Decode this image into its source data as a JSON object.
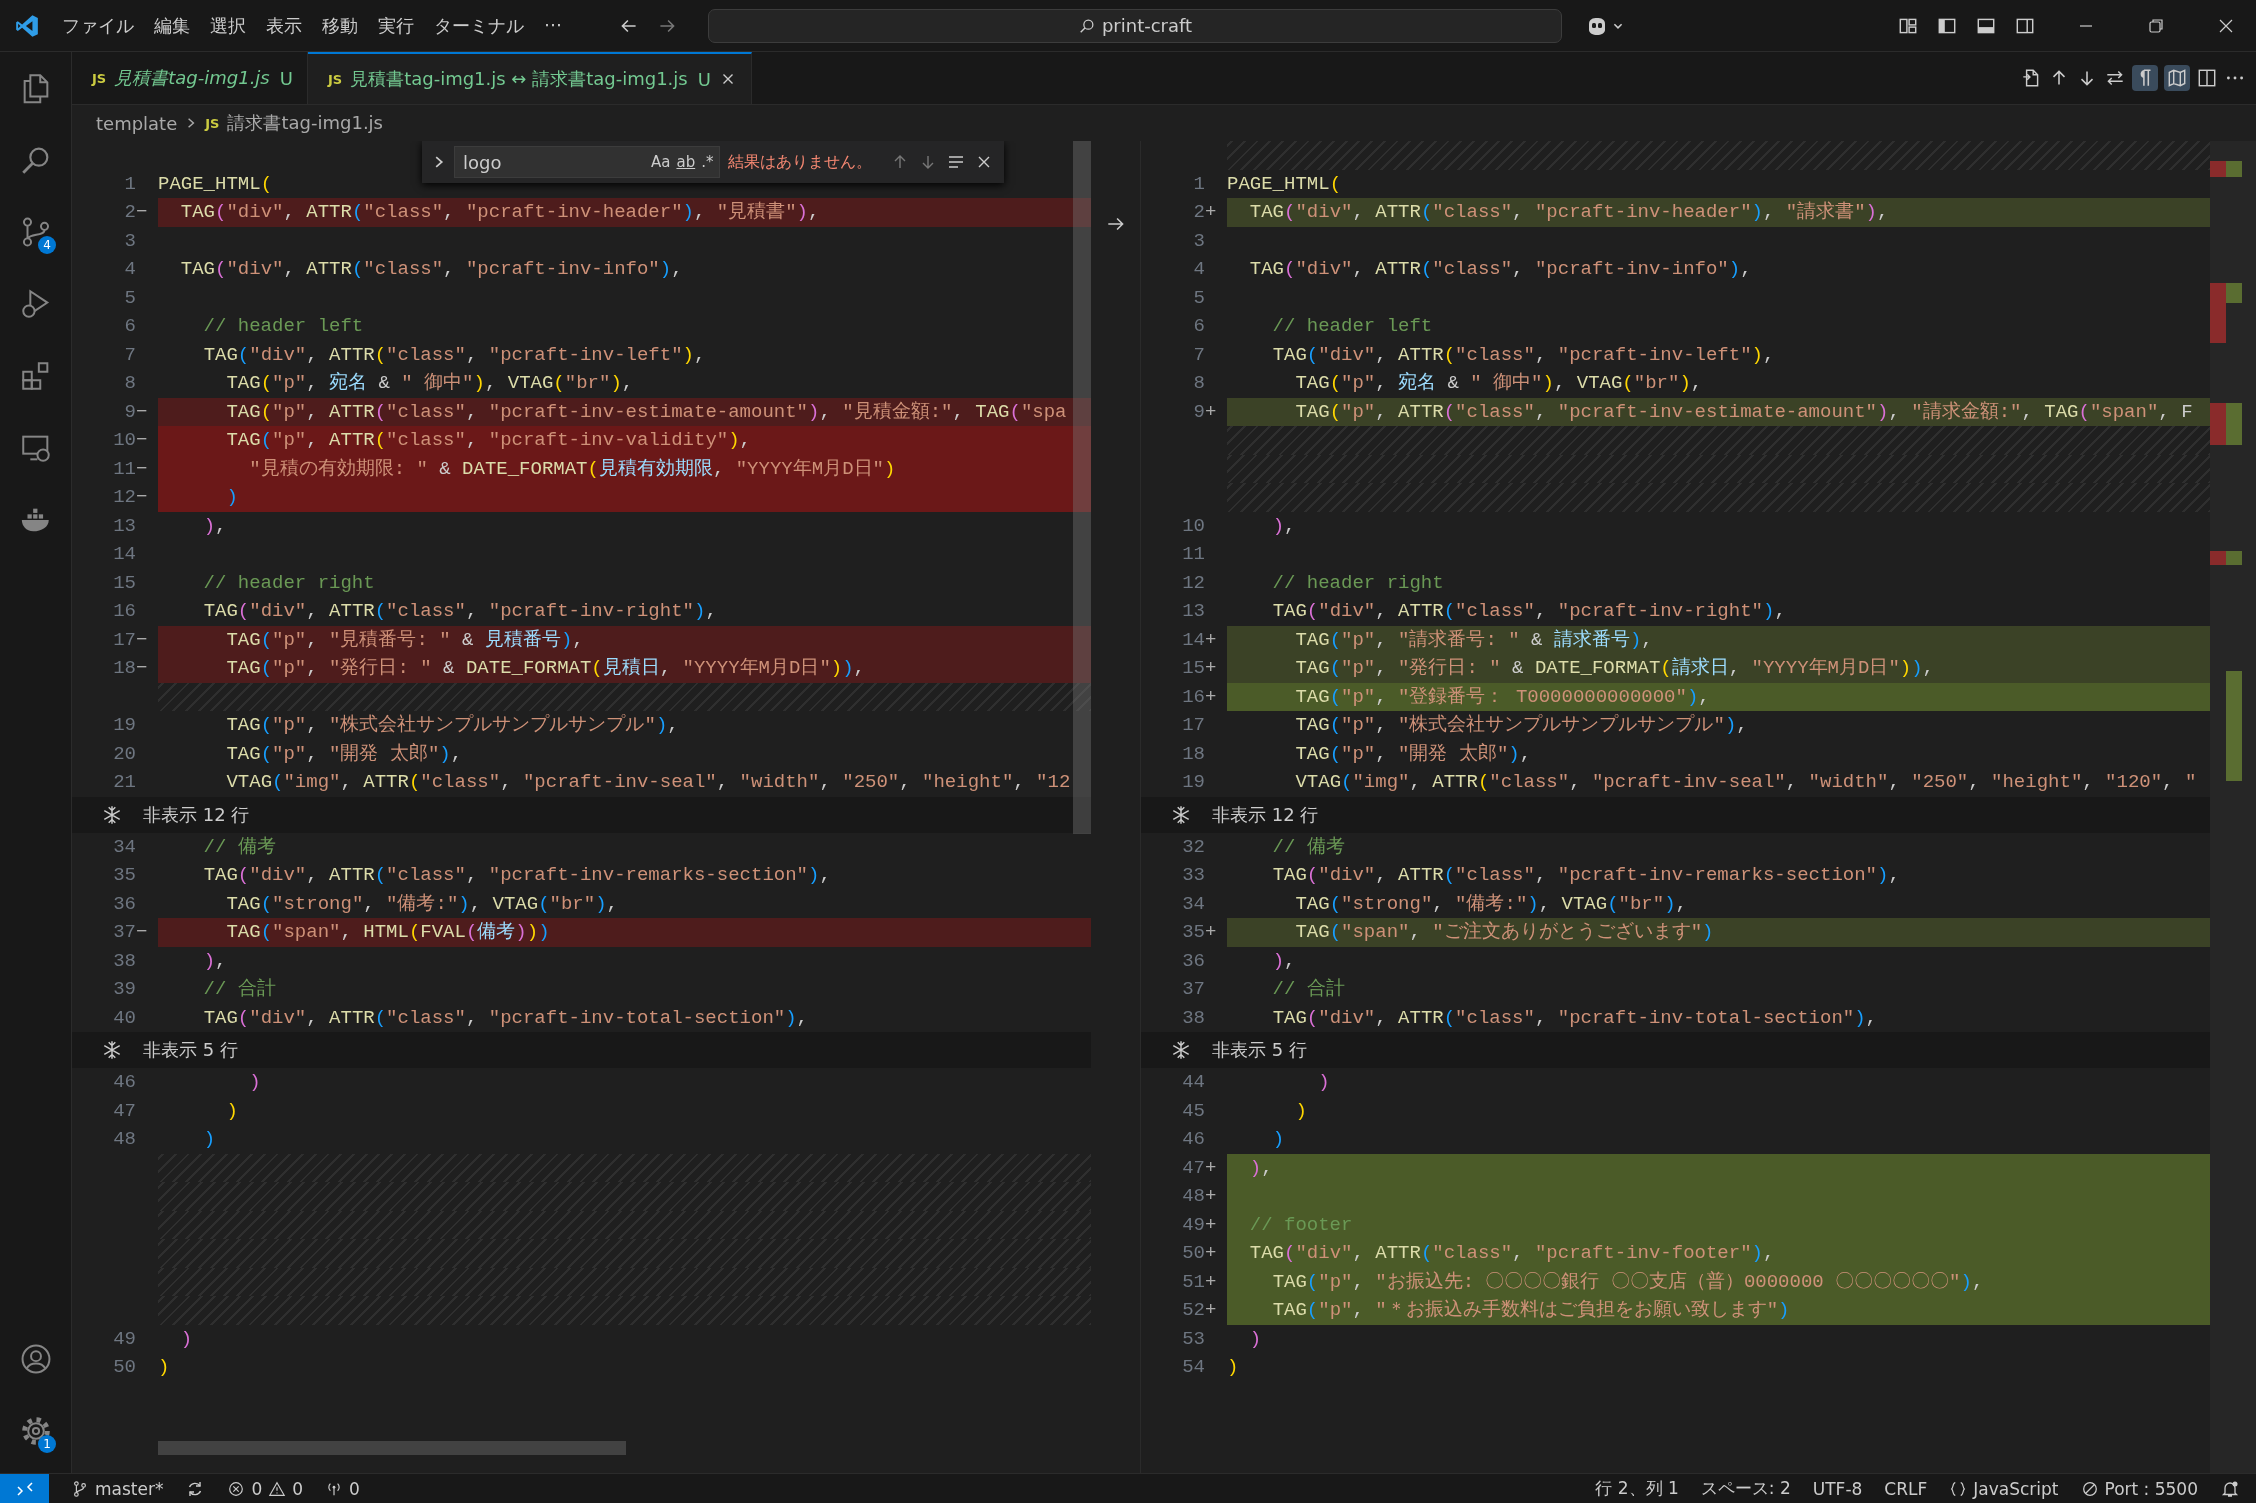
{
  "title_bar": {
    "menu": [
      "ファイル",
      "編集",
      "選択",
      "表示",
      "移動",
      "実行",
      "ターミナル",
      "⋯"
    ],
    "command_center": "print-craft"
  },
  "activity_bar": {
    "source_control_badge": "4",
    "manage_badge": "1"
  },
  "tabs": [
    {
      "file_type": "JS",
      "label": "見積書tag-img1.js",
      "status": "U",
      "selected": false,
      "preview": true
    },
    {
      "file_type": "JS",
      "label": "見積書tag-img1.js ↔ 請求書tag-img1.js",
      "status": "U",
      "selected": true,
      "preview": false
    }
  ],
  "editor_toolbar": {
    "whitespace_toggle_on": true,
    "collapse_unchanged_on": true
  },
  "breadcrumb": {
    "folder": "template",
    "file_type": "JS",
    "file": "請求書tag-img1.js"
  },
  "find_widget": {
    "query": "logo",
    "options": [
      "Aa",
      "ab",
      ".*"
    ],
    "message": "結果はありません。"
  },
  "diff": {
    "left": {
      "rows": [
        {
          "kind": "blank"
        },
        {
          "kind": "line",
          "number": "1",
          "changed": false,
          "whole": false,
          "code": "PAGE_HTML("
        },
        {
          "kind": "line",
          "number": "2",
          "marker": "−",
          "changed": true,
          "whole": false,
          "code": "  TAG(\"div\", ATTR(\"class\", \"pcraft-inv-header\"), \"見積書\"),"
        },
        {
          "kind": "line",
          "number": "3",
          "changed": false,
          "whole": false
        },
        {
          "kind": "line",
          "number": "4",
          "changed": false,
          "whole": false,
          "code": "  TAG(\"div\", ATTR(\"class\", \"pcraft-inv-info\"),"
        },
        {
          "kind": "line",
          "number": "5",
          "changed": false,
          "whole": false
        },
        {
          "kind": "line",
          "number": "6",
          "changed": false,
          "whole": false,
          "code": "    // header left"
        },
        {
          "kind": "line",
          "number": "7",
          "changed": false,
          "whole": false,
          "code": "    TAG(\"div\", ATTR(\"class\", \"pcraft-inv-left\"),"
        },
        {
          "kind": "line",
          "number": "8",
          "changed": false,
          "whole": false,
          "code": "      TAG(\"p\", 宛名 & \" 御中\"), VTAG(\"br\"),"
        },
        {
          "kind": "line",
          "number": "9",
          "marker": "−",
          "changed": true,
          "whole": false,
          "code": "      TAG(\"p\", ATTR(\"class\", \"pcraft-inv-estimate-amount\"), \"見積金額:\", TAG(\"spa"
        },
        {
          "kind": "line",
          "number": "10",
          "marker": "−",
          "changed": true,
          "whole": true,
          "code": "      TAG(\"p\", ATTR(\"class\", \"pcraft-inv-validity\"),"
        },
        {
          "kind": "line",
          "number": "11",
          "marker": "−",
          "changed": true,
          "whole": true,
          "code": "        \"見積の有効期限: \" & DATE_FORMAT(見積有効期限, \"YYYY年M月D日\")"
        },
        {
          "kind": "line",
          "number": "12",
          "marker": "−",
          "changed": true,
          "whole": true,
          "code": "      )"
        },
        {
          "kind": "line",
          "number": "13",
          "changed": false,
          "whole": false,
          "code": "    ),"
        },
        {
          "kind": "line",
          "number": "14",
          "changed": false,
          "whole": false
        },
        {
          "kind": "line",
          "number": "15",
          "changed": false,
          "whole": false,
          "code": "    // header right"
        },
        {
          "kind": "line",
          "number": "16",
          "changed": false,
          "whole": false,
          "code": "    TAG(\"div\", ATTR(\"class\", \"pcraft-inv-right\"),"
        },
        {
          "kind": "line",
          "number": "17",
          "marker": "−",
          "changed": true,
          "whole": false,
          "code": "      TAG(\"p\", \"見積番号: \" & 見積番号),"
        },
        {
          "kind": "line",
          "number": "18",
          "marker": "−",
          "changed": true,
          "whole": false,
          "code": "      TAG(\"p\", \"発行日: \" & DATE_FORMAT(見積日, \"YYYY年M月D日\")),"
        },
        {
          "kind": "filler"
        },
        {
          "kind": "line",
          "number": "19",
          "changed": false,
          "whole": false,
          "code": "      TAG(\"p\", \"株式会社サンプルサンプルサンプル\"),"
        },
        {
          "kind": "line",
          "number": "20",
          "changed": false,
          "whole": false,
          "code": "      TAG(\"p\", \"開発 太郎\"),"
        },
        {
          "kind": "line",
          "number": "21",
          "changed": false,
          "whole": false,
          "code": "      VTAG(\"img\", ATTR(\"class\", \"pcraft-inv-seal\", \"width\", \"250\", \"height\", \"12"
        },
        {
          "kind": "fold",
          "label": "非表示 12 行"
        },
        {
          "kind": "line",
          "number": "34",
          "changed": false,
          "whole": false,
          "code": "    // 備考"
        },
        {
          "kind": "line",
          "number": "35",
          "changed": false,
          "whole": false,
          "code": "    TAG(\"div\", ATTR(\"class\", \"pcraft-inv-remarks-section\"),"
        },
        {
          "kind": "line",
          "number": "36",
          "changed": false,
          "whole": false,
          "code": "      TAG(\"strong\", \"備考:\"), VTAG(\"br\"),"
        },
        {
          "kind": "line",
          "number": "37",
          "marker": "−",
          "changed": true,
          "whole": false,
          "code": "      TAG(\"span\", HTML(FVAL(備考)))"
        },
        {
          "kind": "line",
          "number": "38",
          "changed": false,
          "whole": false,
          "code": "    ),"
        },
        {
          "kind": "line",
          "number": "39",
          "changed": false,
          "whole": false,
          "code": "    // 合計"
        },
        {
          "kind": "line",
          "number": "40",
          "changed": false,
          "whole": false,
          "code": "    TAG(\"div\", ATTR(\"class\", \"pcraft-inv-total-section\"),"
        },
        {
          "kind": "fold",
          "label": "非表示 5 行"
        },
        {
          "kind": "line",
          "number": "46",
          "changed": false,
          "whole": false,
          "code": "        )"
        },
        {
          "kind": "line",
          "number": "47",
          "changed": false,
          "whole": false,
          "code": "      )"
        },
        {
          "kind": "line",
          "number": "48",
          "changed": false,
          "whole": false,
          "code": "    )"
        },
        {
          "kind": "filler"
        },
        {
          "kind": "filler"
        },
        {
          "kind": "filler"
        },
        {
          "kind": "filler"
        },
        {
          "kind": "filler"
        },
        {
          "kind": "filler"
        },
        {
          "kind": "line",
          "number": "49",
          "changed": false,
          "whole": false,
          "code": "  )"
        },
        {
          "kind": "line",
          "number": "50",
          "changed": false,
          "whole": false,
          "code": ")"
        }
      ]
    },
    "right": {
      "rows": [
        {
          "kind": "filler"
        },
        {
          "kind": "line",
          "number": "1",
          "changed": false,
          "whole": false,
          "code": "PAGE_HTML("
        },
        {
          "kind": "line",
          "number": "2",
          "marker": "+",
          "changed": true,
          "whole": false,
          "code": "  TAG(\"div\", ATTR(\"class\", \"pcraft-inv-header\"), \"請求書\"),"
        },
        {
          "kind": "line",
          "number": "3",
          "changed": false,
          "whole": false
        },
        {
          "kind": "line",
          "number": "4",
          "changed": false,
          "whole": false,
          "code": "  TAG(\"div\", ATTR(\"class\", \"pcraft-inv-info\"),"
        },
        {
          "kind": "line",
          "number": "5",
          "changed": false,
          "whole": false
        },
        {
          "kind": "line",
          "number": "6",
          "changed": false,
          "whole": false,
          "code": "    // header left"
        },
        {
          "kind": "line",
          "number": "7",
          "changed": false,
          "whole": false,
          "code": "    TAG(\"div\", ATTR(\"class\", \"pcraft-inv-left\"),"
        },
        {
          "kind": "line",
          "number": "8",
          "changed": false,
          "whole": false,
          "code": "      TAG(\"p\", 宛名 & \" 御中\"), VTAG(\"br\"),"
        },
        {
          "kind": "line",
          "number": "9",
          "marker": "+",
          "changed": true,
          "whole": false,
          "code": "      TAG(\"p\", ATTR(\"class\", \"pcraft-inv-estimate-amount\"), \"請求金額:\", TAG(\"span\", F"
        },
        {
          "kind": "filler"
        },
        {
          "kind": "filler"
        },
        {
          "kind": "filler"
        },
        {
          "kind": "line",
          "number": "10",
          "changed": false,
          "whole": false,
          "code": "    ),"
        },
        {
          "kind": "line",
          "number": "11",
          "changed": false,
          "whole": false
        },
        {
          "kind": "line",
          "number": "12",
          "changed": false,
          "whole": false,
          "code": "    // header right"
        },
        {
          "kind": "line",
          "number": "13",
          "changed": false,
          "whole": false,
          "code": "    TAG(\"div\", ATTR(\"class\", \"pcraft-inv-right\"),"
        },
        {
          "kind": "line",
          "number": "14",
          "marker": "+",
          "changed": true,
          "whole": false,
          "code": "      TAG(\"p\", \"請求番号: \" & 請求番号),"
        },
        {
          "kind": "line",
          "number": "15",
          "marker": "+",
          "changed": true,
          "whole": false,
          "code": "      TAG(\"p\", \"発行日: \" & DATE_FORMAT(請求日, \"YYYY年M月D日\")),"
        },
        {
          "kind": "line",
          "number": "16",
          "marker": "+",
          "changed": true,
          "whole": true,
          "code": "      TAG(\"p\", \"登録番号： T0000000000000\"),"
        },
        {
          "kind": "line",
          "number": "17",
          "changed": false,
          "whole": false,
          "code": "      TAG(\"p\", \"株式会社サンプルサンプルサンプル\"),"
        },
        {
          "kind": "line",
          "number": "18",
          "changed": false,
          "whole": false,
          "code": "      TAG(\"p\", \"開発 太郎\"),"
        },
        {
          "kind": "line",
          "number": "19",
          "changed": false,
          "whole": false,
          "code": "      VTAG(\"img\", ATTR(\"class\", \"pcraft-inv-seal\", \"width\", \"250\", \"height\", \"120\", \""
        },
        {
          "kind": "fold",
          "label": "非表示 12 行"
        },
        {
          "kind": "line",
          "number": "32",
          "changed": false,
          "whole": false,
          "code": "    // 備考"
        },
        {
          "kind": "line",
          "number": "33",
          "changed": false,
          "whole": false,
          "code": "    TAG(\"div\", ATTR(\"class\", \"pcraft-inv-remarks-section\"),"
        },
        {
          "kind": "line",
          "number": "34",
          "changed": false,
          "whole": false,
          "code": "      TAG(\"strong\", \"備考:\"), VTAG(\"br\"),"
        },
        {
          "kind": "line",
          "number": "35",
          "marker": "+",
          "changed": true,
          "whole": false,
          "code": "      TAG(\"span\", \"ご注文ありがとうございます\")"
        },
        {
          "kind": "line",
          "number": "36",
          "changed": false,
          "whole": false,
          "code": "    ),"
        },
        {
          "kind": "line",
          "number": "37",
          "changed": false,
          "whole": false,
          "code": "    // 合計"
        },
        {
          "kind": "line",
          "number": "38",
          "changed": false,
          "whole": false,
          "code": "    TAG(\"div\", ATTR(\"class\", \"pcraft-inv-total-section\"),"
        },
        {
          "kind": "fold",
          "label": "非表示 5 行"
        },
        {
          "kind": "line",
          "number": "44",
          "changed": false,
          "whole": false,
          "code": "        )"
        },
        {
          "kind": "line",
          "number": "45",
          "changed": false,
          "whole": false,
          "code": "      )"
        },
        {
          "kind": "line",
          "number": "46",
          "changed": false,
          "whole": false,
          "code": "    )"
        },
        {
          "kind": "line",
          "number": "47",
          "marker": "+",
          "changed": true,
          "whole": true,
          "code": "  ),"
        },
        {
          "kind": "line",
          "number": "48",
          "marker": "+",
          "changed": true,
          "whole": true
        },
        {
          "kind": "line",
          "number": "49",
          "marker": "+",
          "changed": true,
          "whole": true,
          "code": "  // footer"
        },
        {
          "kind": "line",
          "number": "50",
          "marker": "+",
          "changed": true,
          "whole": true,
          "code": "  TAG(\"div\", ATTR(\"class\", \"pcraft-inv-footer\"),"
        },
        {
          "kind": "line",
          "number": "51",
          "marker": "+",
          "changed": true,
          "whole": true,
          "code": "    TAG(\"p\", \"お振込先: 〇〇〇〇銀行 〇〇支店（普）0000000 〇〇〇〇〇〇\"),"
        },
        {
          "kind": "line",
          "number": "52",
          "marker": "+",
          "changed": true,
          "whole": true,
          "code": "    TAG(\"p\", \"＊お振込み手数料はご負担をお願い致します\")"
        },
        {
          "kind": "line",
          "number": "53",
          "changed": false,
          "whole": false,
          "code": "  )"
        },
        {
          "kind": "line",
          "number": "54",
          "changed": false,
          "whole": false,
          "code": ")"
        }
      ]
    }
  },
  "status_bar": {
    "branch": "master*",
    "errors": "0",
    "warnings": "0",
    "ports": "0",
    "items": [
      "行 2、列 1",
      "スペース: 2",
      "UTF-8",
      "CRLF"
    ],
    "language": "JavaScript",
    "live_server": "Port : 5500"
  }
}
